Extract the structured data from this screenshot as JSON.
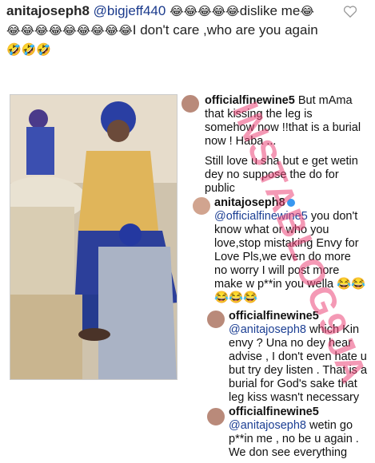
{
  "top_comment": {
    "username": "anitajoseph8",
    "mention": "@bigjeff440",
    "emojis_a": "😂😂😂😂😂",
    "text_a": "dislike me",
    "emojis_b": "😂",
    "emojis_c": "😂😂😂😂😂😂😂😂😂",
    "text_b": "I don't care ,who are you again",
    "emojis_d": "🤣🤣🤣"
  },
  "comments": [
    {
      "username": "officialfinewine5",
      "body": " But mAma that kissing the leg is somehow now !!that is a burial now ! Haba ...",
      "body2": "Still love u sha but e get wetin dey no suppose the do for public"
    },
    {
      "username": "anitajoseph8",
      "mention": "@officialfinewine5",
      "body": " you don't know what or who you love,stop mistaking Envy for Love Pls,we even do more no worry I will post more make w p**in you wella ",
      "emojis": "😂😂😂😂😂"
    },
    {
      "username": "officialfinewine5",
      "mention": "@anitajoseph8",
      "body": " which Kin envy ? Una no dey hear advise , I don't even hate u but try dey listen . That is a burial for God's sake that leg kiss wasn't necessary"
    },
    {
      "username": "officialfinewine5",
      "mention": "@anitajoseph8",
      "body": " wetin go p**in me , no be u again . We don see everything"
    }
  ],
  "watermark": "INSTABLOG9JA",
  "colors": {
    "mention": "#1b3e93",
    "watermark": "#eb4678",
    "verified": "#3897f0"
  }
}
